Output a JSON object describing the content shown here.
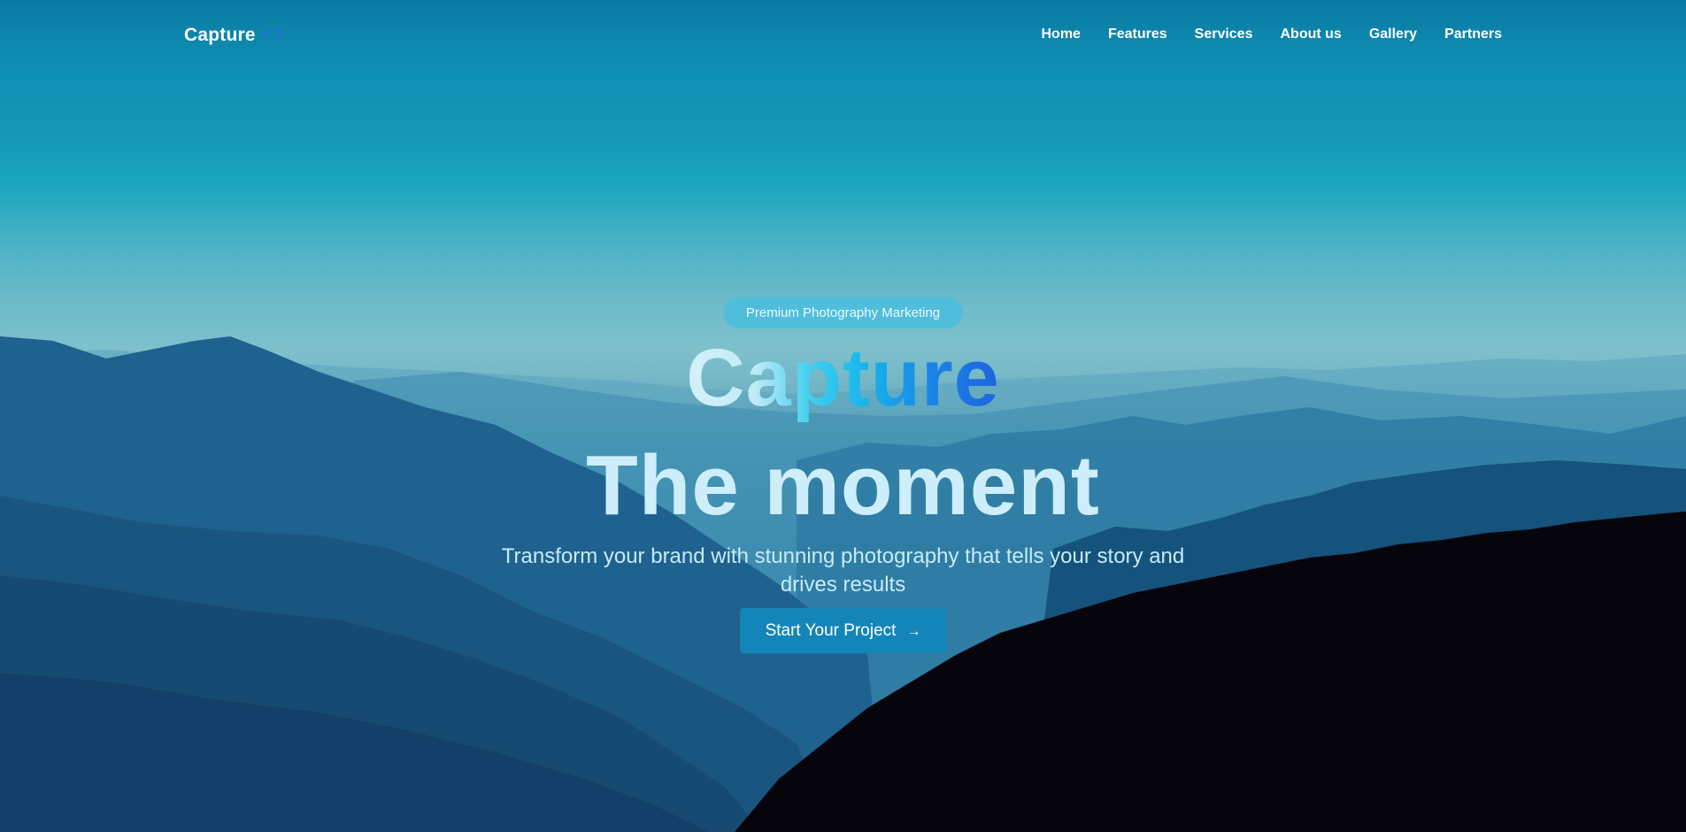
{
  "brand": {
    "name": "Capture",
    "mark": "<3",
    "mark_color": "#1f6fd8"
  },
  "nav": {
    "items": [
      {
        "label": "Home"
      },
      {
        "label": "Features"
      },
      {
        "label": "Services"
      },
      {
        "label": "About us"
      },
      {
        "label": "Gallery"
      },
      {
        "label": "Partners"
      }
    ]
  },
  "hero": {
    "badge": "Premium Photography Marketing",
    "title_line1": "Capture",
    "title_line2": "The moment",
    "subtitle": "Transform your brand with stunning photography that tells your story and drives results",
    "cta_label": "Start Your Project",
    "cta_icon": "arrow-right-icon"
  },
  "colors": {
    "accent": "#1385b9",
    "badge_bg": "#4abede",
    "text_light": "#cdeefa"
  }
}
